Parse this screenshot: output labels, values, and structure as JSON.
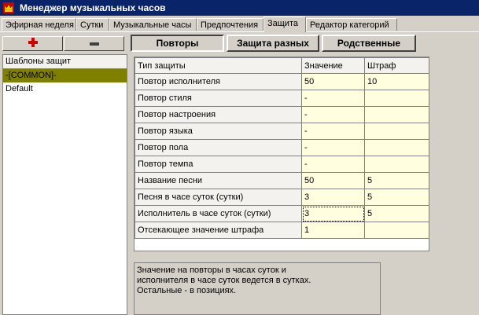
{
  "window": {
    "title": "Менеджер музыкальных часов"
  },
  "tabs": [
    {
      "label": "Эфирная неделя"
    },
    {
      "label": "Сутки"
    },
    {
      "label": "Музыкальные часы"
    },
    {
      "label": "Предпочтения"
    },
    {
      "label": "Защита"
    },
    {
      "label": "Редактор категорий"
    }
  ],
  "active_tab": "Защита",
  "left": {
    "add_icon": "plus-icon",
    "remove_icon": "minus-icon",
    "list_header": "Шаблоны защит",
    "items": [
      {
        "label": "-[COMMON]-",
        "selected": true
      },
      {
        "label": "Default",
        "selected": false
      }
    ]
  },
  "subtabs": [
    {
      "label": "Повторы",
      "pressed": true
    },
    {
      "label": "Защита разных",
      "pressed": false
    },
    {
      "label": "Родственные",
      "pressed": false
    }
  ],
  "grid": {
    "columns": [
      "Тип защиты",
      "Значение",
      "Штраф"
    ],
    "rows": [
      {
        "type": "Повтор исполнителя",
        "value": "50",
        "penalty": "10"
      },
      {
        "type": "Повтор стиля",
        "value": "-",
        "penalty": ""
      },
      {
        "type": "Повтор настроения",
        "value": "-",
        "penalty": ""
      },
      {
        "type": "Повтор языка",
        "value": "-",
        "penalty": ""
      },
      {
        "type": "Повтор пола",
        "value": "-",
        "penalty": ""
      },
      {
        "type": "Повтор темпа",
        "value": "-",
        "penalty": ""
      },
      {
        "type": "Название песни",
        "value": "50",
        "penalty": "5"
      },
      {
        "type": "Песня в часе суток (сутки)",
        "value": "3",
        "penalty": "5"
      },
      {
        "type": "Исполнитель в часе суток (сутки)",
        "value": "3",
        "penalty": "5"
      },
      {
        "type": "Отсекающее значение штрафа",
        "value": "1",
        "penalty": ""
      }
    ]
  },
  "note": {
    "lines": [
      "Значение на повторы в часах суток и",
      "исполнителя в часе суток ведется в сутках.",
      "Остальные - в позициях."
    ]
  },
  "colors": {
    "titlebar": "#0a246a",
    "selected_item": "#808000",
    "value_cell": "#ffffe0"
  }
}
